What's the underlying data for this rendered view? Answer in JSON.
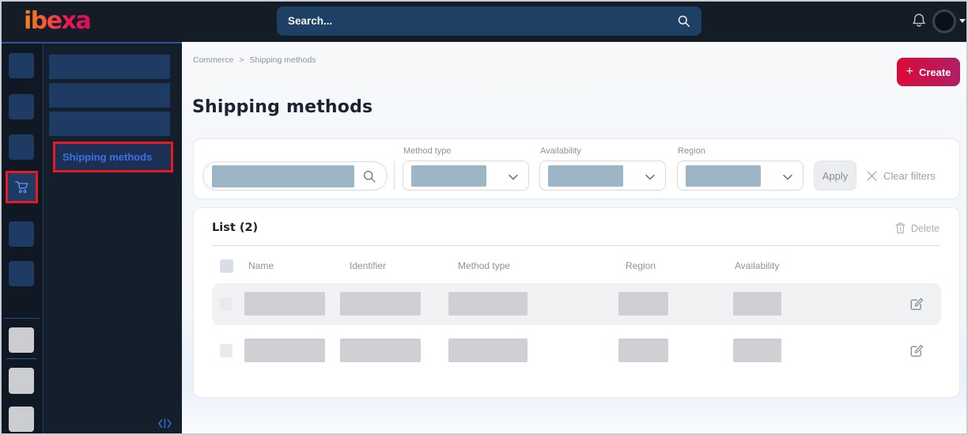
{
  "topbar": {
    "logo_text": "ibexa",
    "search_placeholder": "Search..."
  },
  "sidebar": {
    "active_item_label": "Shipping methods"
  },
  "breadcrumb": {
    "part1": "Commerce",
    "separator": ">",
    "part2": "Shipping methods"
  },
  "page": {
    "title": "Shipping methods",
    "create_plus": "+",
    "create_button": "Create"
  },
  "filters": {
    "method_type_label": "Method type",
    "availability_label": "Availability",
    "region_label": "Region",
    "apply_button": "Apply",
    "clear_filters": "Clear filters"
  },
  "list": {
    "header": "List (2)",
    "delete_button": "Delete",
    "row_count": 2,
    "columns": {
      "name": "Name",
      "identifier": "Identifier",
      "method_type": "Method type",
      "region": "Region",
      "availability": "Availability"
    }
  },
  "colors": {
    "topbar_bg": "#141c27",
    "sidebar_bg": "#151f2b",
    "highlight_border_red": "#e51c23",
    "create_gradient_start": "#dc0a38",
    "create_gradient_end": "#b01e68",
    "active_link_blue": "#3c70e6",
    "placeholder_steel_blue": "#9cb6c5",
    "placeholder_gray": "#cfd0d3",
    "row_shade": "#f1f2f4"
  }
}
